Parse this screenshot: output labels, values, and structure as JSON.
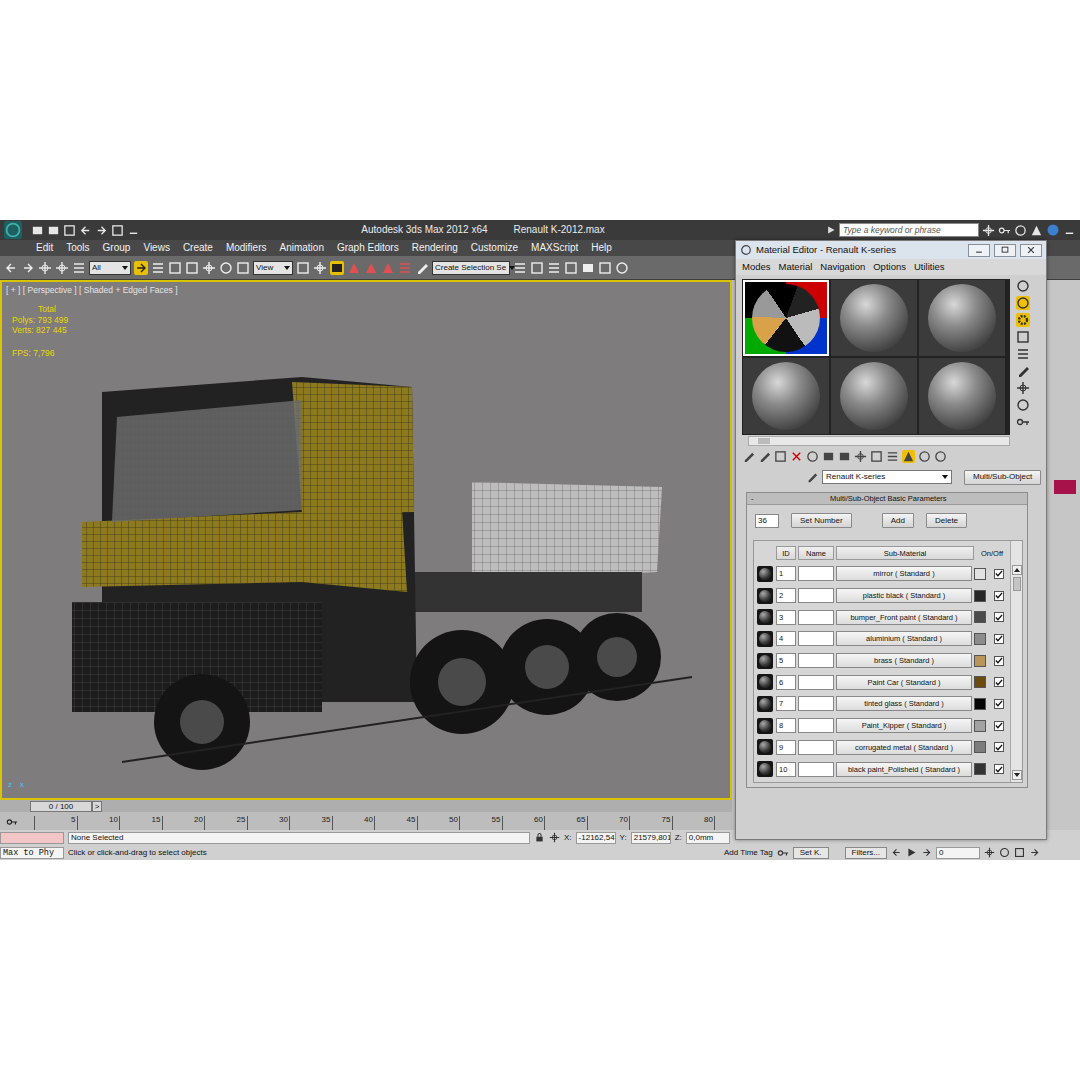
{
  "app": {
    "title": "Autodesk 3ds Max  2012 x64",
    "file": "Renault K-2012.max",
    "search_placeholder": "Type a keyword or phrase"
  },
  "menu": [
    "Edit",
    "Tools",
    "Group",
    "Views",
    "Create",
    "Modifiers",
    "Animation",
    "Graph Editors",
    "Rendering",
    "Customize",
    "MAXScript",
    "Help"
  ],
  "toolbar": {
    "selection_filter": "All",
    "coord_system": "View",
    "named_selection": "Create Selection Se"
  },
  "viewport": {
    "label": "[ + ] [ Perspective ] [ Shaded + Edged Faces ]",
    "stats": [
      "Total",
      "Polys:  793 499",
      "Verts:  827 445"
    ],
    "fps": "FPS:   7,796",
    "axes": [
      "z",
      "x"
    ]
  },
  "timeline": {
    "frame": "0 / 100",
    "next": ">",
    "ticks": [
      "5",
      "10",
      "15",
      "20",
      "25",
      "30",
      "35",
      "40",
      "45",
      "50",
      "55",
      "60",
      "65",
      "70",
      "75",
      "80"
    ]
  },
  "status": {
    "script": "Max to Phy",
    "selection": "None Selected",
    "prompt": "Click or click-and-drag to select objects",
    "x_label": "X:",
    "x": "-12162,54",
    "y_label": "Y:",
    "y": "21579,801",
    "z_label": "Z:",
    "z": "0,0mm",
    "time_tag": "Add Time Tag",
    "set_key": "Set K.",
    "filters": "Filters...",
    "frame": "0"
  },
  "material_editor": {
    "title": "Material Editor - Renault K-series",
    "menu": [
      "Modes",
      "Material",
      "Navigation",
      "Options",
      "Utilities"
    ],
    "samples": [
      {
        "selected": true
      },
      {
        "selected": false
      },
      {
        "selected": false
      },
      {
        "selected": false
      },
      {
        "selected": false
      },
      {
        "selected": false
      }
    ],
    "material_name": "Renault K-series",
    "material_type": "Multi/Sub-Object",
    "rollout_sign": "-",
    "rollout": "Multi/Sub-Object Basic Parameters",
    "count": "36",
    "buttons": [
      "Set Number",
      "Add",
      "Delete"
    ],
    "columns": [
      "ID",
      "Name",
      "Sub-Material",
      "On/Off"
    ],
    "rows": [
      {
        "id": "1",
        "name": "",
        "sub_material": "mirror ( Standard )",
        "color": "#e2e2e2",
        "on": true
      },
      {
        "id": "2",
        "name": "",
        "sub_material": "plastic black ( Standard )",
        "color": "#262626",
        "on": true
      },
      {
        "id": "3",
        "name": "",
        "sub_material": "bumper_Front paint ( Standard )",
        "color": "#4a4a4a",
        "on": true
      },
      {
        "id": "4",
        "name": "",
        "sub_material": "aluminium ( Standard )",
        "color": "#8c8c8c",
        "on": true
      },
      {
        "id": "5",
        "name": "",
        "sub_material": "brass ( Standard )",
        "color": "#b8955a",
        "on": true
      },
      {
        "id": "6",
        "name": "",
        "sub_material": "Paint Car ( Standard )",
        "color": "#6a4c0e",
        "on": true
      },
      {
        "id": "7",
        "name": "",
        "sub_material": "tinted glass ( Standard )",
        "color": "#050505",
        "on": true
      },
      {
        "id": "8",
        "name": "",
        "sub_material": "Paint_Kipper ( Standard )",
        "color": "#a2a2a2",
        "on": true
      },
      {
        "id": "9",
        "name": "",
        "sub_material": "corrugated metal ( Standard )",
        "color": "#7c7c7c",
        "on": true
      },
      {
        "id": "10",
        "name": "",
        "sub_material": "black paint_Polisheid ( Standard )",
        "color": "#333333",
        "on": true
      }
    ]
  }
}
